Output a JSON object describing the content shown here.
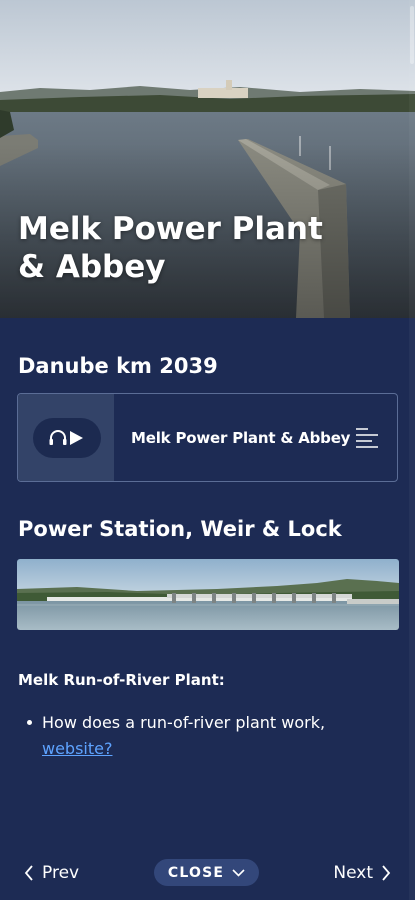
{
  "hero": {
    "title": "Melk Power Plant & Abbey"
  },
  "section": {
    "km_heading": "Danube km 2039"
  },
  "audio": {
    "track_title": "Melk Power Plant & Abbey"
  },
  "power_station": {
    "heading": "Power Station, Weir & Lock"
  },
  "plant": {
    "label": "Melk Run-of-River Plant:",
    "bullet_text": "How does a run-of-river plant work,",
    "link_text": "website?"
  },
  "nav": {
    "prev": "Prev",
    "close": "CLOSE",
    "next": "Next"
  },
  "colors": {
    "background": "#1d2b54",
    "card_left": "#334368",
    "close_button": "#33477a",
    "link": "#5ea3ff"
  },
  "icons": [
    "headphones-icon",
    "play-icon",
    "list-icon",
    "chevron-left-icon",
    "chevron-down-icon",
    "chevron-right-icon"
  ]
}
